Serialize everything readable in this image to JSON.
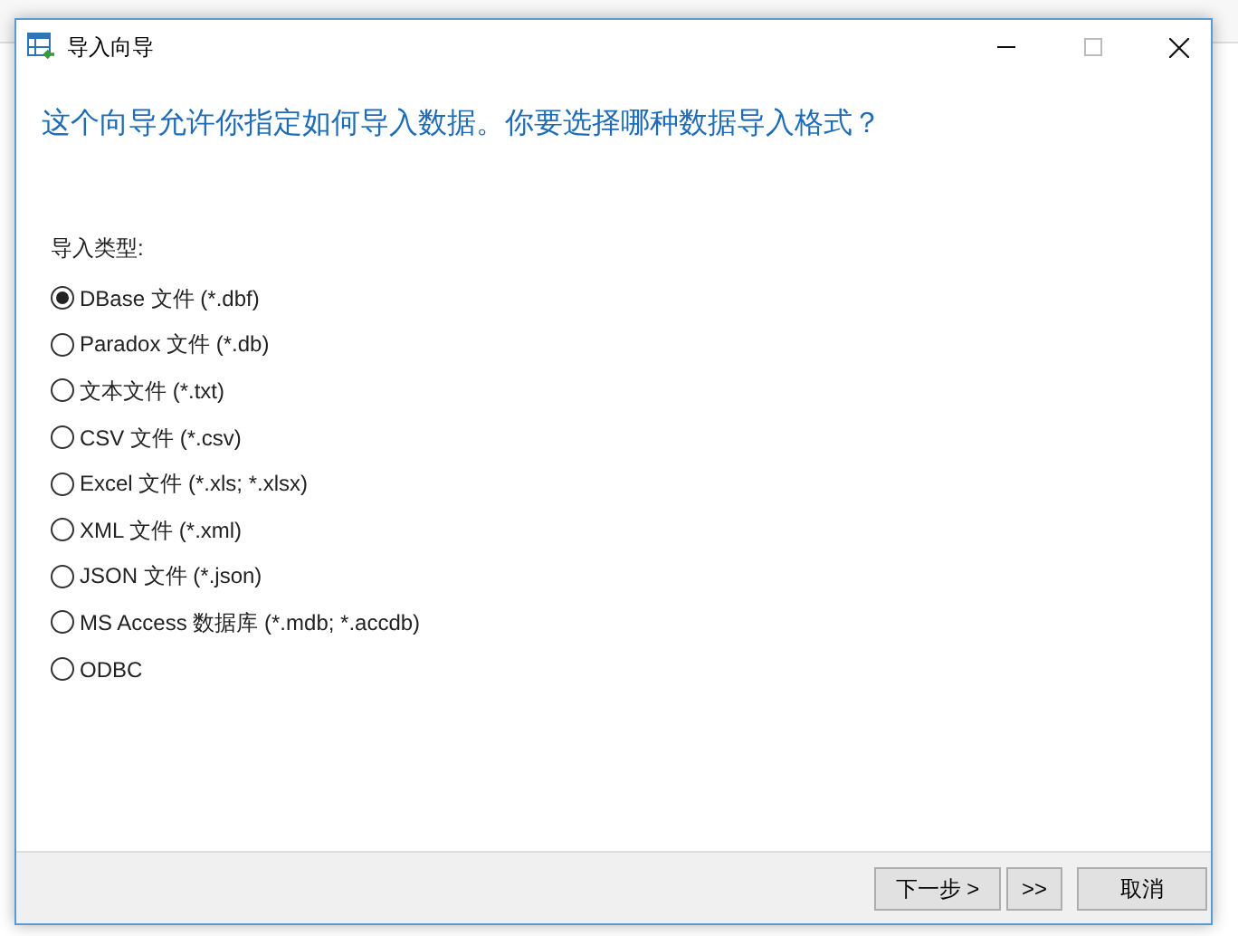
{
  "window": {
    "title": "导入向导"
  },
  "heading": "这个向导允许你指定如何导入数据。你要选择哪种数据导入格式？",
  "group_label": "导入类型:",
  "options": [
    {
      "label": "DBase 文件 (*.dbf)",
      "selected": true
    },
    {
      "label": "Paradox 文件 (*.db)",
      "selected": false
    },
    {
      "label": "文本文件 (*.txt)",
      "selected": false
    },
    {
      "label": "CSV 文件 (*.csv)",
      "selected": false
    },
    {
      "label": "Excel 文件 (*.xls; *.xlsx)",
      "selected": false
    },
    {
      "label": "XML 文件 (*.xml)",
      "selected": false
    },
    {
      "label": "JSON 文件 (*.json)",
      "selected": false
    },
    {
      "label": "MS Access 数据库 (*.mdb; *.accdb)",
      "selected": false
    },
    {
      "label": "ODBC",
      "selected": false
    }
  ],
  "buttons": [
    {
      "label": "下一步 >",
      "kind": "next"
    },
    {
      "label": ">>",
      "kind": "finish"
    },
    {
      "label": "取消",
      "kind": "cancel"
    }
  ]
}
